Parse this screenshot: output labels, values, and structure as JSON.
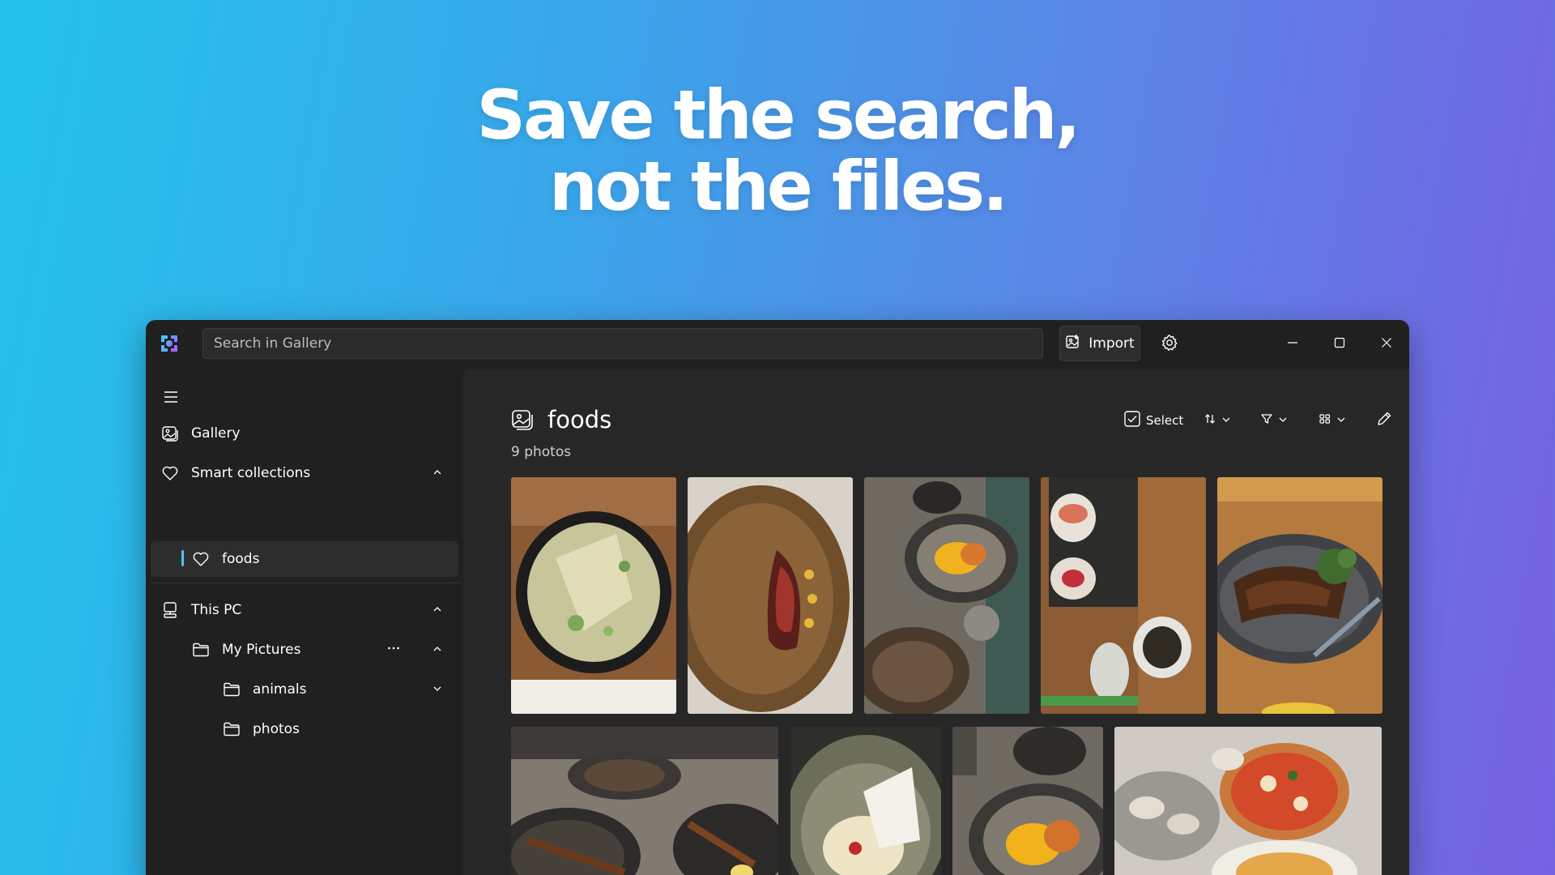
{
  "headline": {
    "line1": "Save the search,",
    "line2": "not the files."
  },
  "titlebar": {
    "search_placeholder": "Search in Gallery",
    "import_label": "Import",
    "icons": [
      "app-logo-icon",
      "import-icon",
      "gear-icon",
      "minimize-icon",
      "maximize-icon",
      "close-icon"
    ]
  },
  "sidebar": {
    "gallery_label": "Gallery",
    "smart_collections_label": "Smart collections",
    "foods_label": "foods",
    "this_pc_label": "This PC",
    "my_pictures_label": "My Pictures",
    "animals_label": "animals",
    "photos_label": "photos"
  },
  "main": {
    "title": "foods",
    "count": "9 photos",
    "select_label": "Select"
  },
  "colors": {
    "accent": "#4cc2ff",
    "window_bg": "#202020",
    "content_bg": "#272727",
    "gradient_left": "#22c2ea",
    "gradient_right": "#7760e2"
  }
}
